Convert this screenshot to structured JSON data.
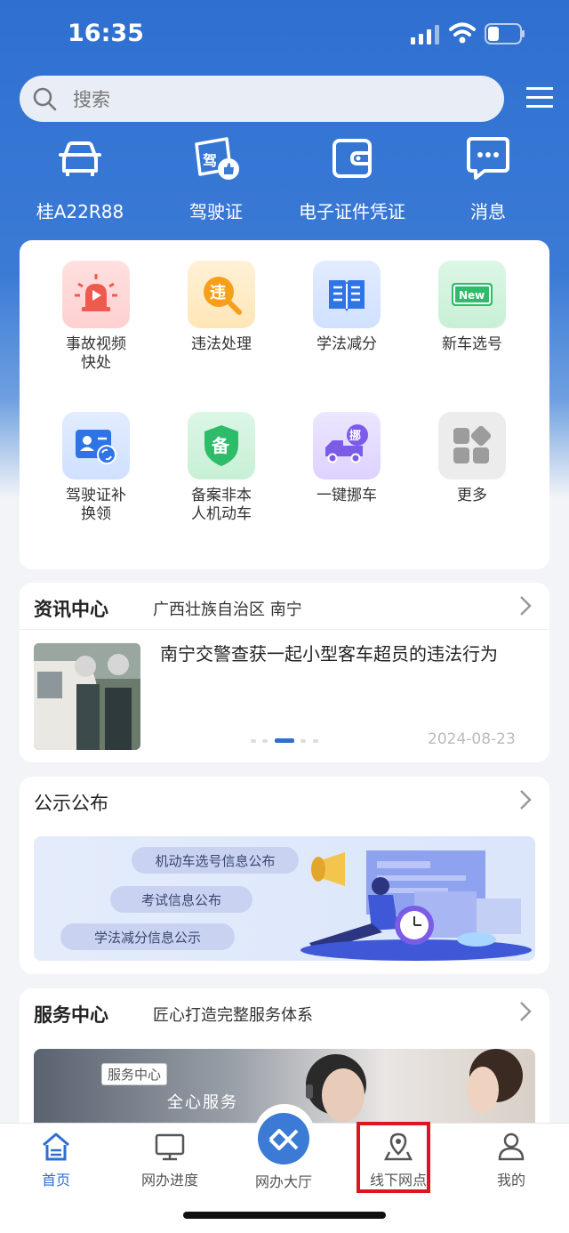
{
  "status": {
    "time": "16:35"
  },
  "search": {
    "placeholder": "搜索"
  },
  "quick": [
    {
      "label": "桂A22R88",
      "icon": "car-icon"
    },
    {
      "label": "驾驶证",
      "icon": "license-icon"
    },
    {
      "label": "电子证件凭证",
      "icon": "wallet-icon"
    },
    {
      "label": "消息",
      "icon": "message-icon"
    }
  ],
  "services": [
    {
      "label": "事故视频快处",
      "icon": "siren-icon"
    },
    {
      "label": "违法处理",
      "icon": "violation-icon"
    },
    {
      "label": "学法减分",
      "icon": "book-icon"
    },
    {
      "label": "新车选号",
      "icon": "plate-icon"
    },
    {
      "label": "驾驶证补换领",
      "icon": "id-card-icon"
    },
    {
      "label": "备案非本人机动车",
      "icon": "shield-icon"
    },
    {
      "label": "一键挪车",
      "icon": "tow-truck-icon"
    },
    {
      "label": "更多",
      "icon": "more-icon"
    }
  ],
  "service_icon_texts": {
    "violation": "违",
    "plate": "New",
    "shield": "备",
    "tow": "挪"
  },
  "news": {
    "title": "资讯中心",
    "region": "广西壮族自治区 南宁",
    "headline": "南宁交警查获一起小型客车超员的违法行为",
    "date": "2024-08-23"
  },
  "notice": {
    "title": "公示公布",
    "pills": [
      "机动车选号信息公布",
      "考试信息公布",
      "学法减分信息公示"
    ]
  },
  "service_center": {
    "title": "服务中心",
    "subtitle": "匠心打造完整服务体系",
    "banner_tag": "服务中心",
    "banner_text": "全心服务"
  },
  "tabs": [
    {
      "label": "首页",
      "active": true
    },
    {
      "label": "网办进度"
    },
    {
      "label": "网办大厅"
    },
    {
      "label": "线下网点",
      "highlighted": true
    },
    {
      "label": "我的"
    }
  ],
  "colors": {
    "primary": "#2f6fd0",
    "highlight_box": "#e0141e"
  }
}
